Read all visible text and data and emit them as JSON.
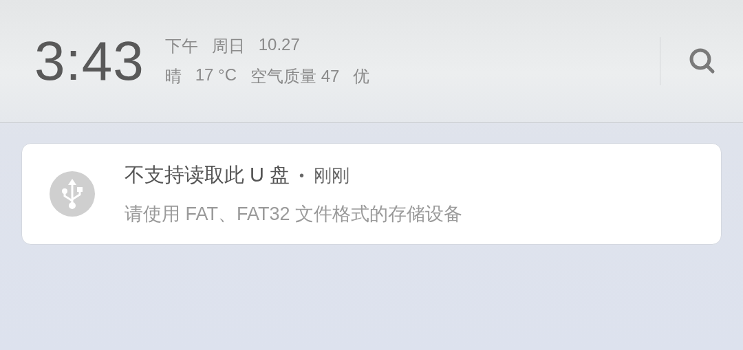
{
  "clock": {
    "time": "3:43",
    "date_line": [
      "下午",
      "周日",
      "10.27"
    ],
    "weather_line": [
      "晴",
      "17 °C",
      "空气质量 47",
      "优"
    ]
  },
  "notifications": [
    {
      "title": "不支持读取此 U 盘",
      "separator": "•",
      "time": "刚刚",
      "message": "请使用 FAT、FAT32 文件格式的存储设备"
    }
  ]
}
